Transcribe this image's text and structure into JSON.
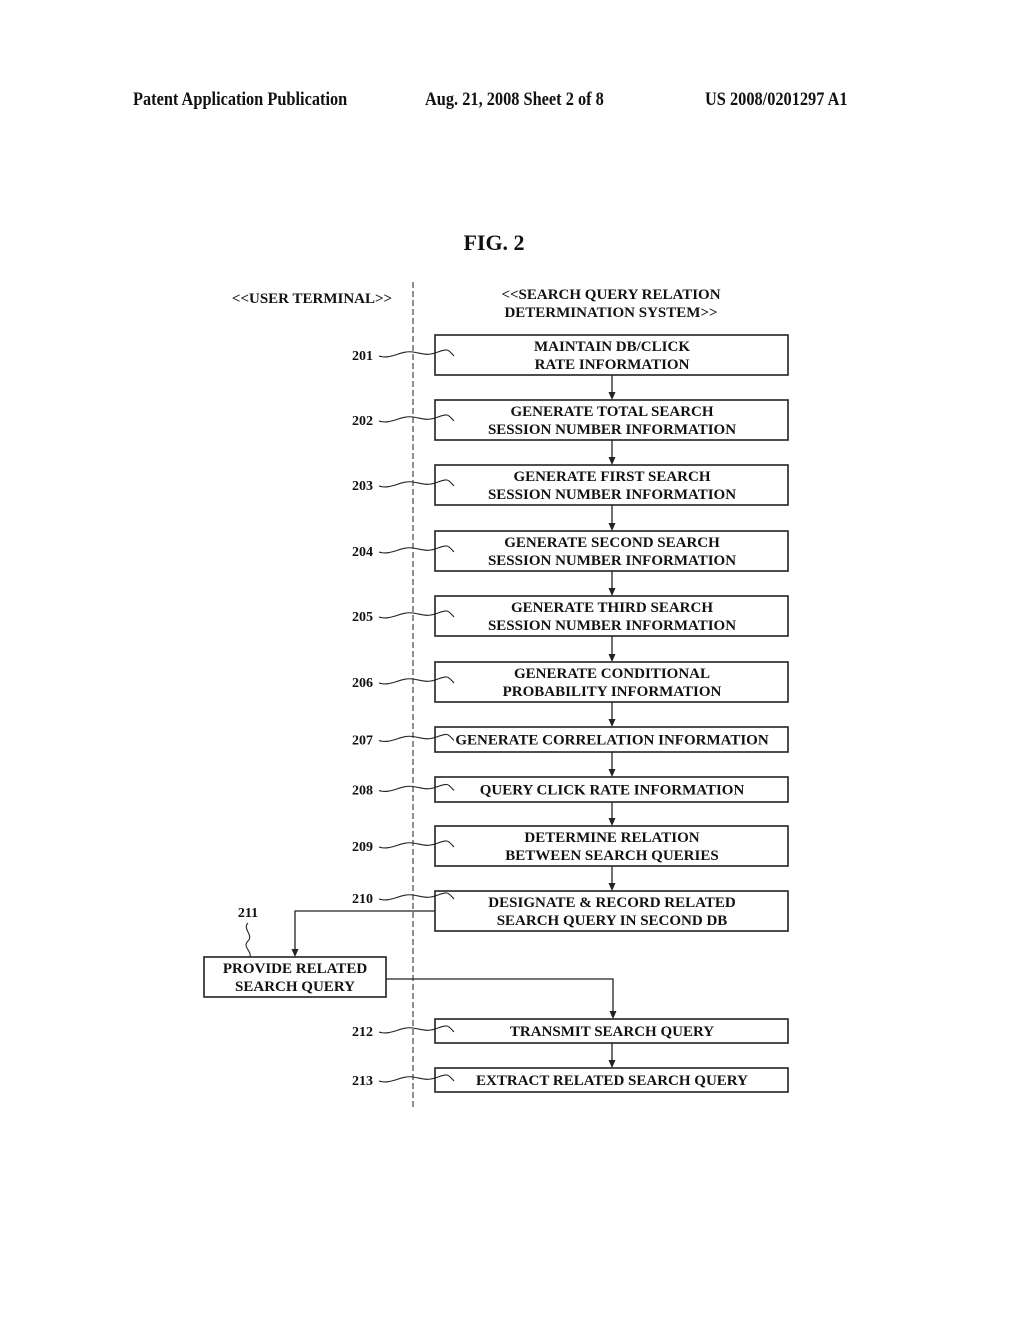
{
  "header": {
    "left": "Patent Application Publication",
    "center": "Aug. 21, 2008  Sheet 2 of 8",
    "right": "US 2008/0201297 A1"
  },
  "figure": {
    "title": "FIG. 2",
    "lanes": {
      "left": "<<USER TERMINAL>>",
      "right_line1": "<<SEARCH QUERY RELATION",
      "right_line2": "DETERMINATION SYSTEM>>"
    },
    "steps": [
      {
        "ref": "201",
        "lines": [
          "MAINTAIN DB/CLICK",
          "RATE INFORMATION"
        ]
      },
      {
        "ref": "202",
        "lines": [
          "GENERATE TOTAL SEARCH",
          "SESSION NUMBER INFORMATION"
        ]
      },
      {
        "ref": "203",
        "lines": [
          "GENERATE FIRST SEARCH",
          "SESSION NUMBER INFORMATION"
        ]
      },
      {
        "ref": "204",
        "lines": [
          "GENERATE SECOND SEARCH",
          "SESSION NUMBER INFORMATION"
        ]
      },
      {
        "ref": "205",
        "lines": [
          "GENERATE THIRD SEARCH",
          "SESSION NUMBER INFORMATION"
        ]
      },
      {
        "ref": "206",
        "lines": [
          "GENERATE CONDITIONAL",
          "PROBABILITY INFORMATION"
        ]
      },
      {
        "ref": "207",
        "lines": [
          "GENERATE CORRELATION INFORMATION"
        ]
      },
      {
        "ref": "208",
        "lines": [
          "QUERY CLICK RATE INFORMATION"
        ]
      },
      {
        "ref": "209",
        "lines": [
          "DETERMINE RELATION",
          "BETWEEN SEARCH QUERIES"
        ]
      },
      {
        "ref": "210",
        "lines": [
          "DESIGNATE & RECORD RELATED",
          "SEARCH QUERY IN SECOND DB"
        ]
      },
      {
        "ref": "212",
        "lines": [
          "TRANSMIT SEARCH QUERY"
        ]
      },
      {
        "ref": "213",
        "lines": [
          "EXTRACT RELATED SEARCH QUERY"
        ]
      }
    ],
    "terminal_step": {
      "ref": "211",
      "lines": [
        "PROVIDE RELATED",
        "SEARCH QUERY"
      ]
    }
  }
}
